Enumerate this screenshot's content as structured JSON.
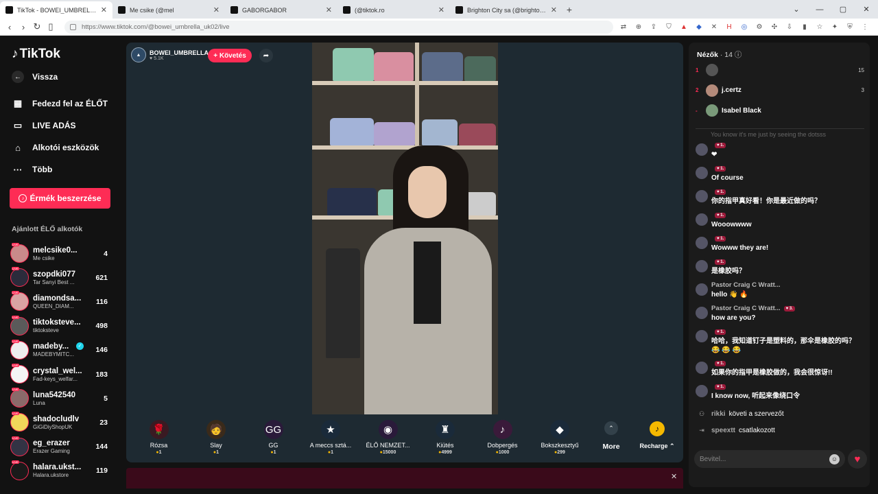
{
  "browser": {
    "tabs": [
      {
        "title": "TikTok - BOWEI_UMBRELLA (@bowei",
        "active": true
      },
      {
        "title": "Me csike (@mel",
        "active": false
      },
      {
        "title": "GABORGABOR",
        "active": false
      },
      {
        "title": "(@tiktok.ro",
        "active": false
      },
      {
        "title": "Brighton City sa (@brighton.city) ÉLŐ",
        "active": false
      }
    ],
    "url": "https://www.tiktok.com/@bowei_umbrella_uk02/live"
  },
  "sidebar": {
    "logo": "TikTok",
    "back": "Vissza",
    "nav": [
      {
        "label": "Fedezd fel az ÉLŐT",
        "icon": "calendar-icon"
      },
      {
        "label": "LIVE ADÁS",
        "icon": "camera-icon"
      },
      {
        "label": "Alkotói eszközök",
        "icon": "house-icon"
      },
      {
        "label": "Több",
        "icon": "more-icon"
      }
    ],
    "coins_button": "Érmék beszerzése",
    "section_title": "Ajánlott ÉLŐ alkotók",
    "creators": [
      {
        "name": "melcsike0...",
        "sub": "Me csike",
        "count": "4",
        "color": "#c98a8a"
      },
      {
        "name": "szopdki077",
        "sub": "Tar Sanyi Best ...",
        "count": "621",
        "color": "#2b2b3b"
      },
      {
        "name": "diamondsa...",
        "sub": "QUEEN_DIAM...",
        "count": "116",
        "color": "#d9a3a3"
      },
      {
        "name": "tiktoksteve...",
        "sub": "tiktoksteve",
        "count": "498",
        "color": "#5a5a5a"
      },
      {
        "name": "madeby...",
        "sub": "MADEBYMITC...",
        "count": "146",
        "color": "#eeeeee",
        "verified": true
      },
      {
        "name": "crystal_wel...",
        "sub": "Fad-keys_welfar...",
        "count": "183",
        "color": "#f4f4f4"
      },
      {
        "name": "luna542540",
        "sub": "Luna",
        "count": "5",
        "color": "#8a6a6a"
      },
      {
        "name": "shadocludlv",
        "sub": "GiGiDiyShopUK",
        "count": "23",
        "color": "#f0d65a"
      },
      {
        "name": "eg_erazer",
        "sub": "Erazer Gaming",
        "count": "144",
        "color": "#333344"
      },
      {
        "name": "halara.ukst...",
        "sub": "Halara.ukstore",
        "count": "119",
        "color": "#1a1a1a"
      }
    ]
  },
  "stream": {
    "host_name": "BOWEI_UMBRELLA",
    "likes": "5.1K",
    "follow_button": "+ Követés"
  },
  "gifts": [
    {
      "name": "Rózsa",
      "price": "1",
      "emoji": "🌹",
      "bg": "#3a1a22"
    },
    {
      "name": "Slay",
      "price": "1",
      "emoji": "🧑",
      "bg": "#3a2a1a"
    },
    {
      "name": "GG",
      "price": "1",
      "emoji": "GG",
      "bg": "#2a1a3a"
    },
    {
      "name": "A meccs sztá...",
      "price": "1",
      "emoji": "★",
      "bg": "#1a2a3a"
    },
    {
      "name": "ÉLŐ NEMZET...",
      "price": "15000",
      "emoji": "◉",
      "bg": "#2a1a3a"
    },
    {
      "name": "Kiütés",
      "price": "4999",
      "emoji": "♜",
      "bg": "#1a2a3a"
    },
    {
      "name": "Dobpergés",
      "price": "1000",
      "emoji": "♪",
      "bg": "#3a1a3a"
    },
    {
      "name": "Bokszkesztyű",
      "price": "299",
      "emoji": "◆",
      "bg": "#1a2a3a"
    }
  ],
  "more_label": "More",
  "recharge_label": "Recharge",
  "chat": {
    "viewers_label": "Nézők",
    "viewers_count": "· 14",
    "top_viewers": [
      {
        "rank": "1",
        "name": "",
        "score": "15",
        "color": "#555"
      },
      {
        "rank": "2",
        "name": "j.certz",
        "score": "3",
        "color": "#b48a7a"
      },
      {
        "rank": "-",
        "name": "Isabel Black",
        "score": "",
        "color": "#7a9a7a"
      }
    ],
    "faded_message": "You know it's me just by seeing the dotsss",
    "messages": [
      {
        "user": "",
        "badge": "1",
        "text": "❤",
        "tall": false
      },
      {
        "user": "",
        "badge": "1",
        "text": "Of course",
        "tall": false
      },
      {
        "user": "",
        "badge": "1",
        "text": "你的指甲真好看！你是最近做的吗？",
        "tall": false
      },
      {
        "user": "",
        "badge": "1",
        "text": "Wooowwww",
        "tall": false
      },
      {
        "user": "",
        "badge": "1",
        "text": "Wowww they are!",
        "tall": false
      },
      {
        "user": "",
        "badge": "1",
        "text": "是橡胶吗？",
        "tall": false
      },
      {
        "user": "Pastor Craig C Wratt...",
        "badge": "",
        "text": "hello 👋 🔥",
        "tall": false
      },
      {
        "user": "Pastor Craig C Wratt...",
        "badge": "3",
        "text": "how are you?",
        "tall": false
      },
      {
        "user": "",
        "badge": "1",
        "text": "哈哈，我知道钉子是塑料的，那伞是橡胶的吗？ 😂 😂 😂",
        "tall": true
      },
      {
        "user": "",
        "badge": "1",
        "text": "如果你的指甲是橡胶做的，我会很惊讶!!",
        "tall": false
      },
      {
        "user": "",
        "badge": "1",
        "text": "I know now, 听起来像绕口令",
        "tall": false
      }
    ],
    "system": [
      {
        "user": "rikki",
        "text": "követi a szervezőt",
        "icon": "follow-icon"
      },
      {
        "user": "speextt",
        "text": "csatlakozott",
        "icon": "join-icon"
      }
    ],
    "input_placeholder": "Bevitel..."
  }
}
